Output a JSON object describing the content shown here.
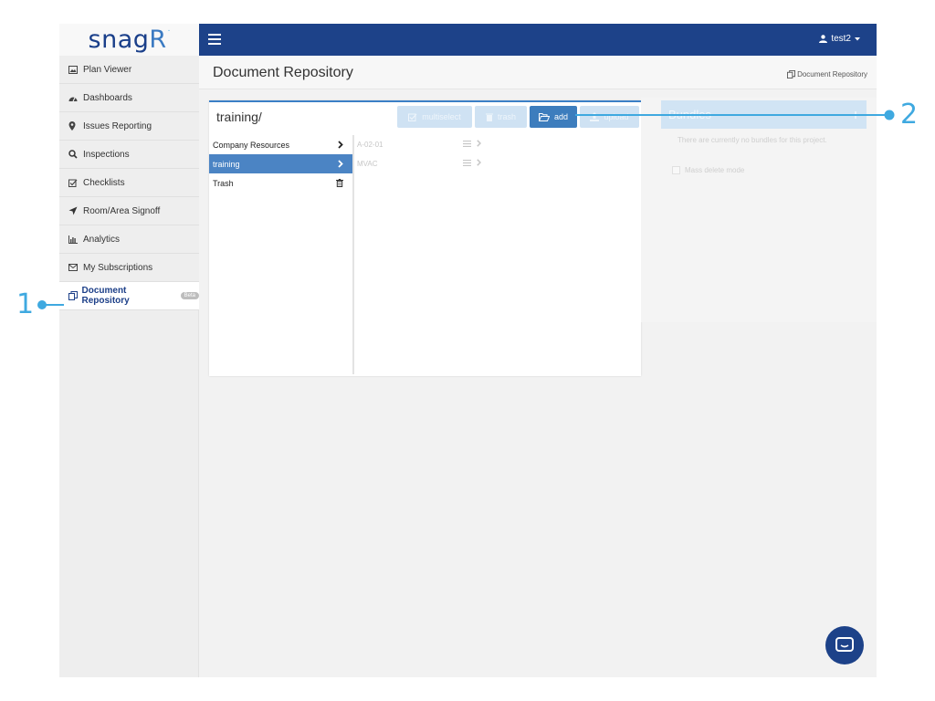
{
  "app": {
    "logo_text": "snag",
    "logo_r": "R",
    "logo_dot": "."
  },
  "sidebar": {
    "items": [
      {
        "label": "Plan Viewer",
        "icon": "image-icon"
      },
      {
        "label": "Dashboards",
        "icon": "dashboard-icon"
      },
      {
        "label": "Issues Reporting",
        "icon": "map-marker-icon"
      },
      {
        "label": "Inspections",
        "icon": "search-icon"
      },
      {
        "label": "Checklists",
        "icon": "checkbox-icon"
      },
      {
        "label": "Room/Area Signoff",
        "icon": "location-arrow-icon"
      },
      {
        "label": "Analytics",
        "icon": "bar-chart-icon"
      },
      {
        "label": "My Subscriptions",
        "icon": "envelope-icon"
      },
      {
        "label": "Document Repository",
        "icon": "documents-icon",
        "active": true,
        "badge": "Beta"
      }
    ]
  },
  "topbar": {
    "user": "test2"
  },
  "page": {
    "title": "Document Repository",
    "breadcrumb": "Document Repository"
  },
  "repo": {
    "path": "training/",
    "toolbar": {
      "multiselect": "multiselect",
      "trash": "trash",
      "add": "add",
      "upload": "upload"
    },
    "folders": [
      {
        "name": "Company Resources"
      },
      {
        "name": "training"
      },
      {
        "name": "Trash"
      }
    ],
    "files": [
      {
        "name": "A-02-01"
      },
      {
        "name": "MVAC"
      }
    ]
  },
  "bundles": {
    "title": "Bundles",
    "empty": "There are currently no bundles for this project.",
    "mass_delete": "Mass delete mode"
  },
  "annotations": {
    "one": "1",
    "two": "2"
  },
  "colors": {
    "navbar": "#1d4289",
    "accent": "#3fa9e0",
    "selected": "#4b84c4"
  }
}
